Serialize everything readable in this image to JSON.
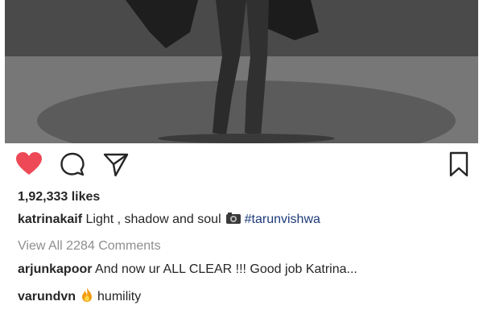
{
  "post": {
    "likes_text": "1,92,333 likes",
    "caption": {
      "username": "katrinakaif",
      "text": "Light , shadow and soul",
      "emoji_icon": "camera-icon",
      "hashtag": "#tarunvishwa"
    },
    "view_all_comments": "View All 2284 Comments",
    "comments": [
      {
        "username": "arjunkapoor",
        "text": "And now ur ALL CLEAR !!! Good job Katrina..."
      },
      {
        "username": "varundvn",
        "emoji_icon": "fire-icon",
        "text": "humility"
      }
    ]
  },
  "actions": {
    "like": "heart-icon",
    "comment": "comment-icon",
    "share": "share-icon",
    "save": "bookmark-icon"
  },
  "colors": {
    "like_active": "#ed4956",
    "text": "#262626",
    "muted": "#8e8e8e",
    "hashtag": "#1e3a7b"
  }
}
